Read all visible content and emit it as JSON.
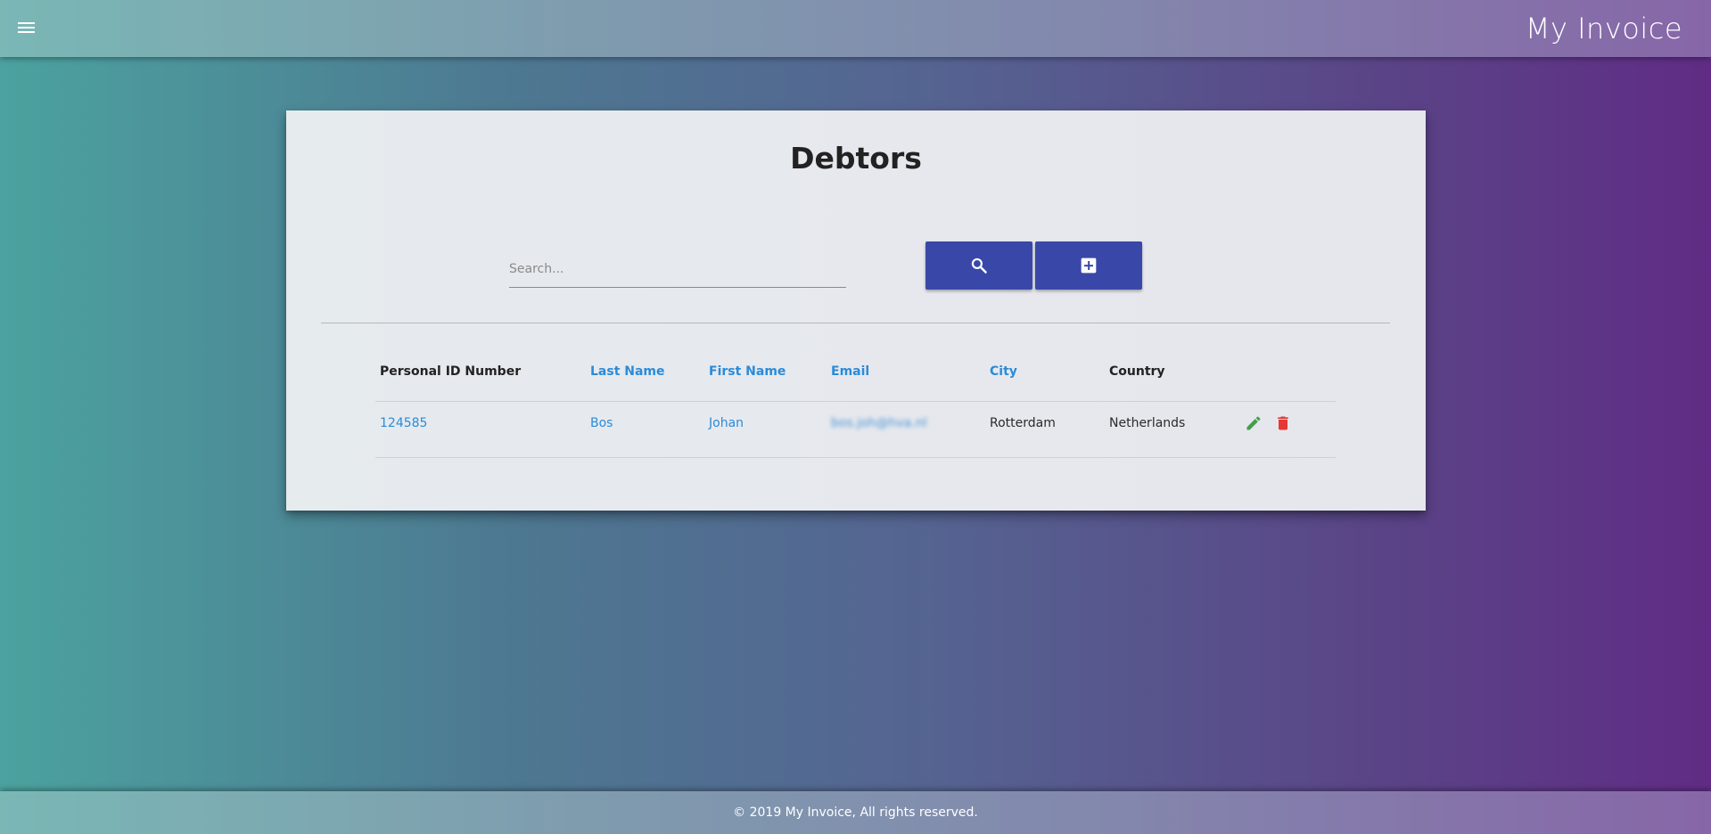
{
  "header": {
    "menu_icon": "hamburger-menu-icon",
    "app_title": "My Invoice"
  },
  "page": {
    "title": "Debtors"
  },
  "search": {
    "placeholder": "Search...",
    "value": "",
    "search_button_icon": "search-icon",
    "add_button_icon": "add-box-icon",
    "button_color": "#3948a8"
  },
  "table": {
    "headers": {
      "personal_id": "Personal ID Number",
      "last_name": "Last Name",
      "first_name": "First Name",
      "email": "Email",
      "city": "City",
      "country": "Country"
    },
    "rows": [
      {
        "personal_id": "124585",
        "last_name": "Bos",
        "first_name": "Johan",
        "email": "bos.joh@hva.nl",
        "city": "Rotterdam",
        "country": "Netherlands",
        "edit_icon": "pencil-icon",
        "delete_icon": "trash-icon"
      }
    ],
    "link_color": "#2a8bd9",
    "edit_color": "#43a047",
    "delete_color": "#e53935"
  },
  "footer": {
    "text": "© 2019 My Invoice, All rights reserved."
  }
}
